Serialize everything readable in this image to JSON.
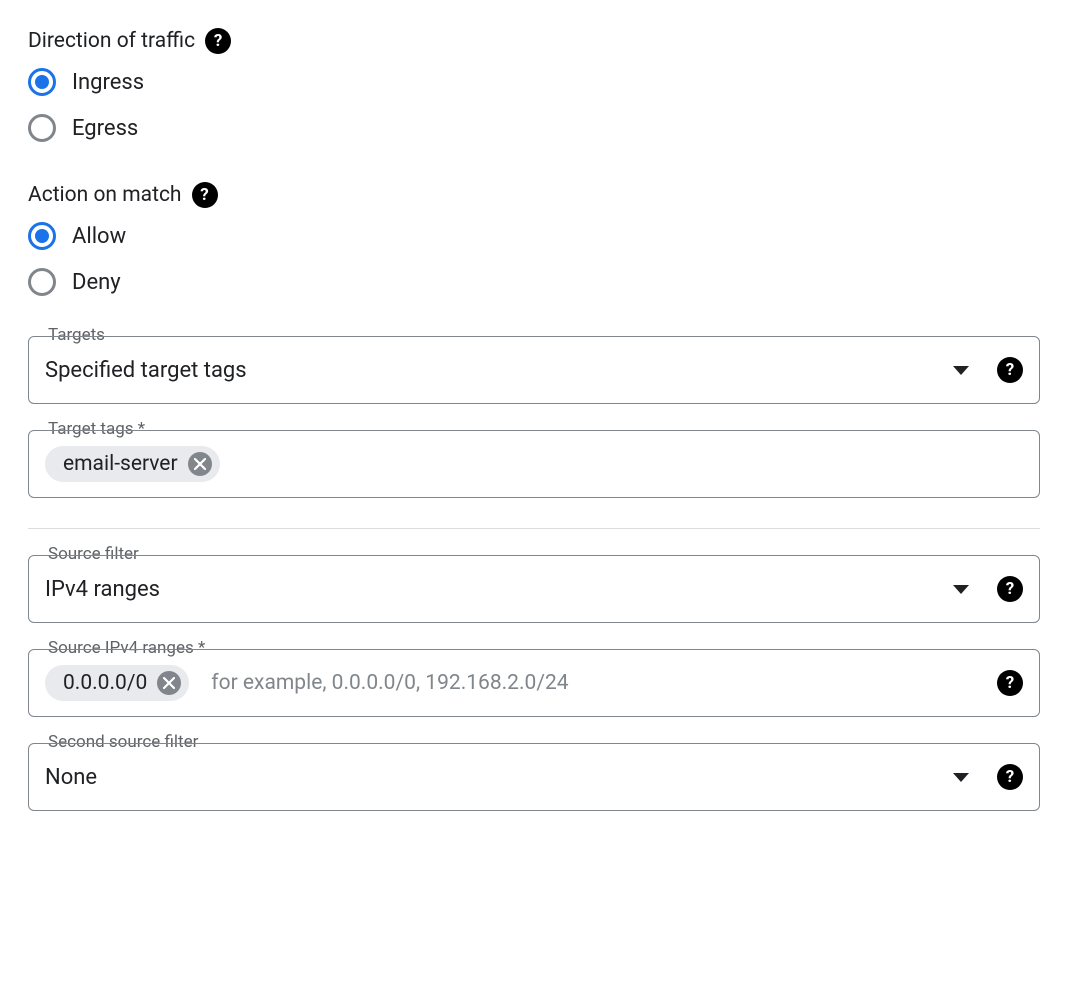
{
  "direction": {
    "label": "Direction of traffic",
    "options": {
      "ingress": "Ingress",
      "egress": "Egress"
    }
  },
  "action": {
    "label": "Action on match",
    "options": {
      "allow": "Allow",
      "deny": "Deny"
    }
  },
  "targets": {
    "label": "Targets",
    "value": "Specified target tags"
  },
  "target_tags": {
    "label": "Target tags *",
    "chips": [
      "email-server"
    ]
  },
  "source_filter": {
    "label": "Source filter",
    "value": "IPv4 ranges"
  },
  "source_ipv4": {
    "label": "Source IPv4 ranges *",
    "chips": [
      "0.0.0.0/0"
    ],
    "placeholder": "for example, 0.0.0.0/0, 192.168.2.0/24"
  },
  "second_source_filter": {
    "label": "Second source filter",
    "value": "None"
  }
}
